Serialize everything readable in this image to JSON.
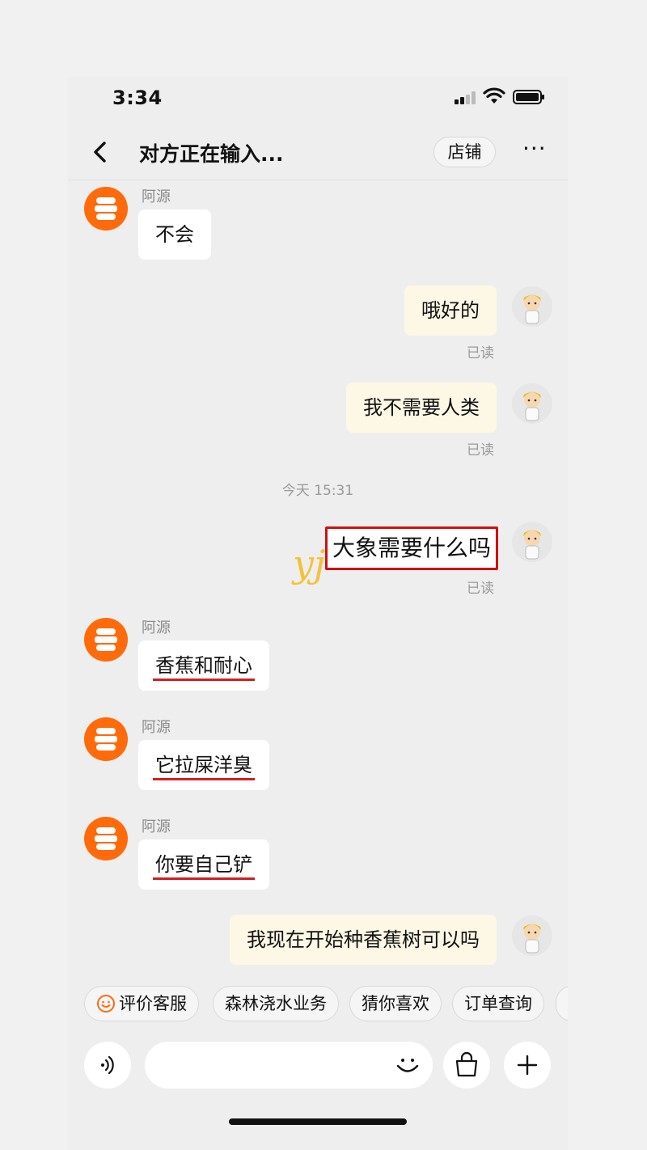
{
  "status": {
    "time": "3:34"
  },
  "header": {
    "title": "对方正在输入...",
    "shop_label": "店铺",
    "more_label": "···"
  },
  "messages": [
    {
      "side": "in",
      "sender": "阿源",
      "text": "不会"
    },
    {
      "side": "out",
      "text": "哦好的",
      "read": "已读"
    },
    {
      "side": "out",
      "text": "我不需要人类",
      "read": "已读"
    },
    {
      "type": "timestamp",
      "text": "今天 15:31"
    },
    {
      "side": "out",
      "text": "大象需要什么吗",
      "read": "已读",
      "highlighted": true
    },
    {
      "side": "in",
      "sender": "阿源",
      "text": "香蕉和耐心",
      "underlined": true
    },
    {
      "side": "in",
      "sender": "阿源",
      "text": "它拉屎洋臭",
      "underlined": true
    },
    {
      "side": "in",
      "sender": "阿源",
      "text": "你要自己铲",
      "underlined": true
    },
    {
      "side": "out",
      "text": "我现在开始种香蕉树可以吗"
    }
  ],
  "watermark": "yj",
  "quick_replies": [
    "评价客服",
    "森林浇水业务",
    "猜你喜欢",
    "订单查询"
  ],
  "input": {
    "placeholder": ""
  },
  "colors": {
    "shop_avatar": "#ff6a0a",
    "bubble_out": "#fdf7e6",
    "bubble_in": "#ffffff",
    "highlight": "#d01010",
    "underline": "#d21f1f"
  },
  "icons": [
    "back-icon",
    "more-icon",
    "smile-icon",
    "voice-icon",
    "emoji-icon",
    "bag-icon",
    "plus-icon"
  ]
}
